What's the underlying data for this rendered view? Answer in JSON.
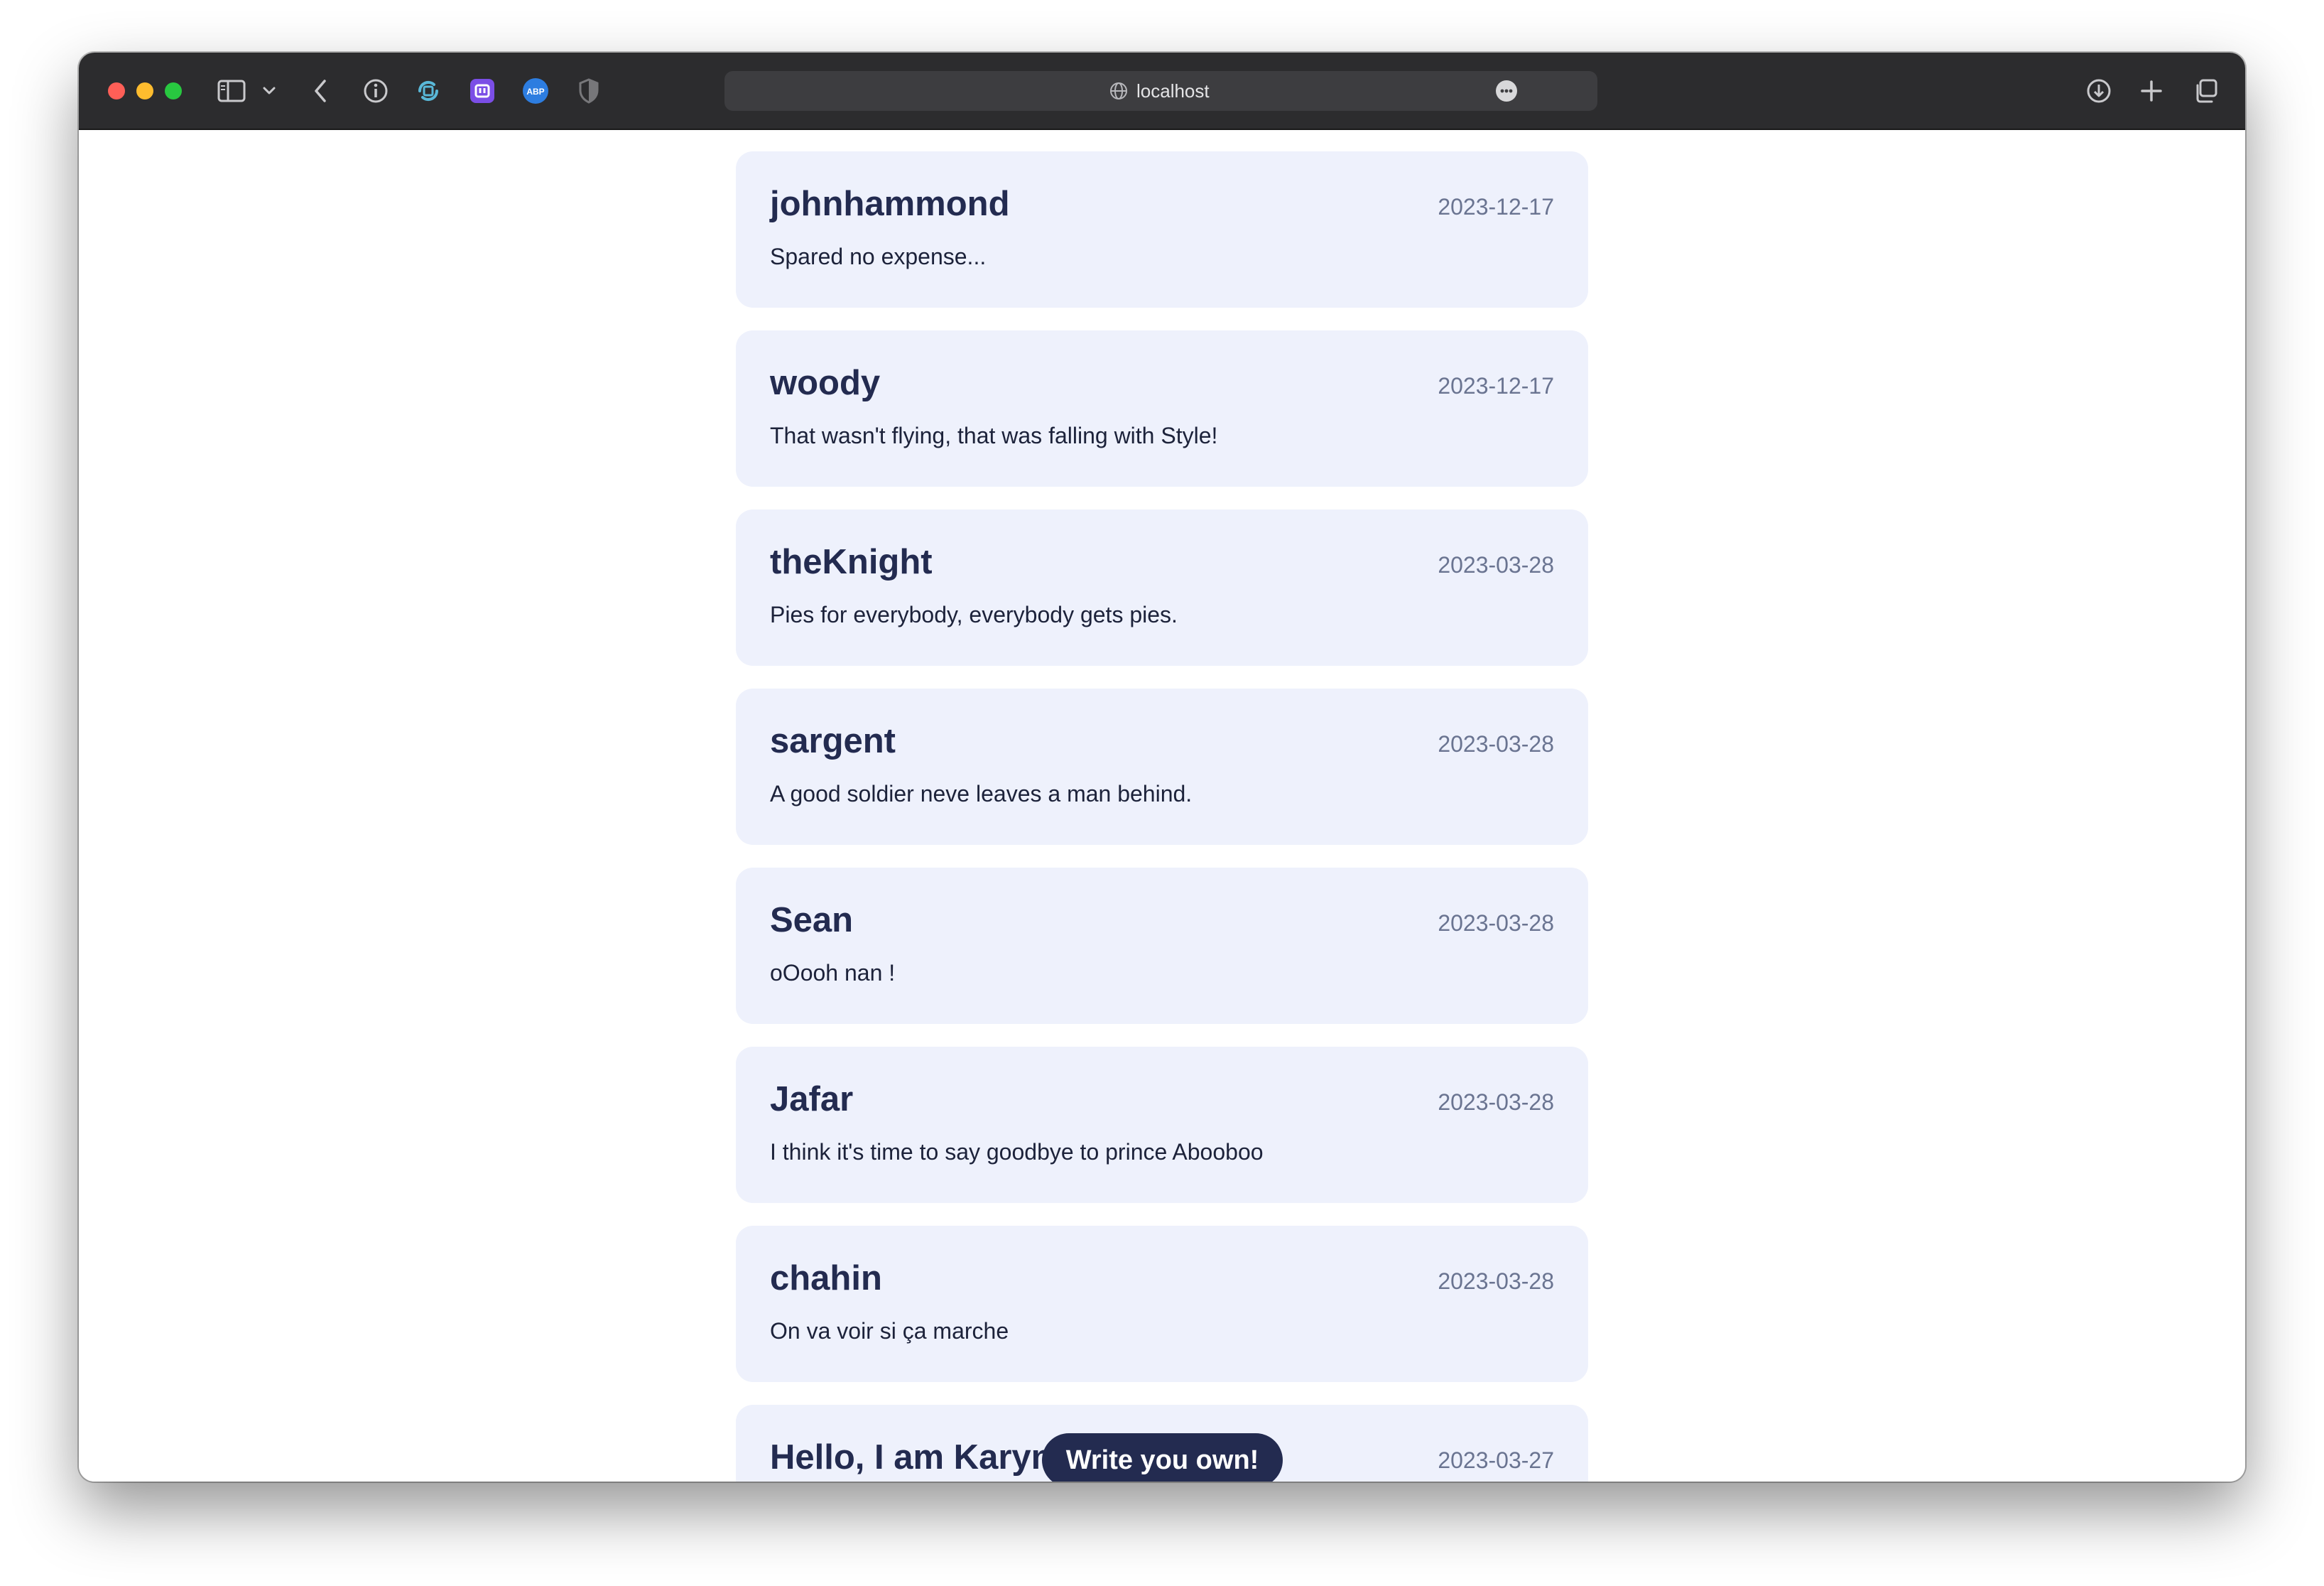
{
  "browser": {
    "url": "localhost",
    "icons": [
      "sidebar-icon",
      "chevron-down-icon",
      "back-icon",
      "info-icon",
      "extension-sync-icon",
      "extension-purple-icon",
      "adblock-icon",
      "privacy-shield-icon",
      "globe-icon",
      "more-icon",
      "download-icon",
      "new-tab-icon",
      "tab-overview-icon"
    ]
  },
  "posts": [
    {
      "user": "johnhammond",
      "date": "2023-12-17",
      "message": "Spared no expense..."
    },
    {
      "user": "woody",
      "date": "2023-12-17",
      "message": "That wasn't flying, that was falling with Style!"
    },
    {
      "user": "theKnight",
      "date": "2023-03-28",
      "message": "Pies for everybody, everybody gets pies."
    },
    {
      "user": "sargent",
      "date": "2023-03-28",
      "message": "A good soldier neve leaves a man behind."
    },
    {
      "user": "Sean",
      "date": "2023-03-28",
      "message": "oOooh nan !"
    },
    {
      "user": "Jafar",
      "date": "2023-03-28",
      "message": "I think it's time to say goodbye to prince Abooboo"
    },
    {
      "user": "chahin",
      "date": "2023-03-28",
      "message": "On va voir si ça marche"
    },
    {
      "user": "Hello, I am Karyna!!!!",
      "date": "2023-03-27",
      "message": ""
    }
  ],
  "write_button": "Write you own!",
  "colors": {
    "card_bg": "#eef1fc",
    "accent": "#232b50",
    "date": "#6a7491",
    "toolbar": "#2c2c2e"
  }
}
